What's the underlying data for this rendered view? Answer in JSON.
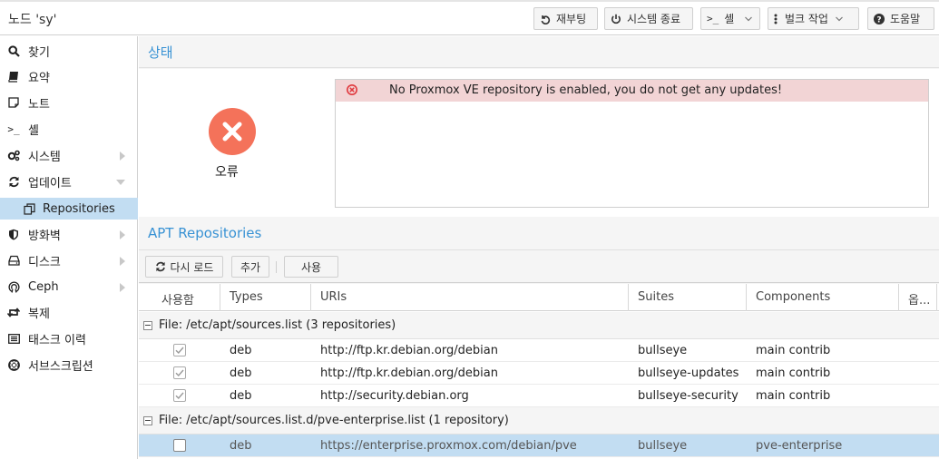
{
  "node": {
    "title": "노드 'sy'"
  },
  "topbar": {
    "reboot_label": "재부팅",
    "shutdown_label": "시스템 종료",
    "shell_label": "셸",
    "bulk_label": "벌크 작업",
    "help_label": "도움말"
  },
  "sidebar": {
    "items": [
      {
        "label": "찾기",
        "icon": "search-icon"
      },
      {
        "label": "요약",
        "icon": "book-icon"
      },
      {
        "label": "노트",
        "icon": "note-icon"
      },
      {
        "label": "셸",
        "icon": "terminal-icon"
      },
      {
        "label": "시스템",
        "icon": "gears-icon"
      },
      {
        "label": "업데이트",
        "icon": "refresh-icon"
      },
      {
        "label": "Repositories",
        "icon": "copy-icon"
      },
      {
        "label": "방화벽",
        "icon": "shield-icon"
      },
      {
        "label": "디스크",
        "icon": "hdd-icon"
      },
      {
        "label": "Ceph",
        "icon": "ceph-icon"
      },
      {
        "label": "복제",
        "icon": "retweet-icon"
      },
      {
        "label": "태스크 이력",
        "icon": "list-icon"
      },
      {
        "label": "서브스크립션",
        "icon": "support-icon"
      }
    ]
  },
  "status": {
    "heading": "상태",
    "state_label": "오류",
    "message": "No Proxmox VE repository is enabled, you do not get any updates!"
  },
  "apt": {
    "heading": "APT Repositories",
    "reload_label": "다시 로드",
    "add_label": "추가",
    "enable_label": "사용",
    "columns": [
      "사용함",
      "Types",
      "URIs",
      "Suites",
      "Components",
      "옵..."
    ],
    "groups": [
      {
        "label": "File: /etc/apt/sources.list (3 repositories)",
        "rows": [
          {
            "enabled": true,
            "type": "deb",
            "uri": "http://ftp.kr.debian.org/debian",
            "suite": "bullseye",
            "components": "main contrib"
          },
          {
            "enabled": true,
            "type": "deb",
            "uri": "http://ftp.kr.debian.org/debian",
            "suite": "bullseye-updates",
            "components": "main contrib"
          },
          {
            "enabled": true,
            "type": "deb",
            "uri": "http://security.debian.org",
            "suite": "bullseye-security",
            "components": "main contrib"
          }
        ]
      },
      {
        "label": "File: /etc/apt/sources.list.d/pve-enterprise.list (1 repository)",
        "rows": [
          {
            "enabled": false,
            "type": "deb",
            "uri": "https://enterprise.proxmox.com/debian/pve",
            "suite": "bullseye",
            "components": "pve-enterprise"
          }
        ]
      }
    ]
  },
  "colors": {
    "accent": "#3892d4",
    "error": "#f4725a",
    "selected": "#c2ddf2",
    "error_row": "#f2d4d5"
  }
}
